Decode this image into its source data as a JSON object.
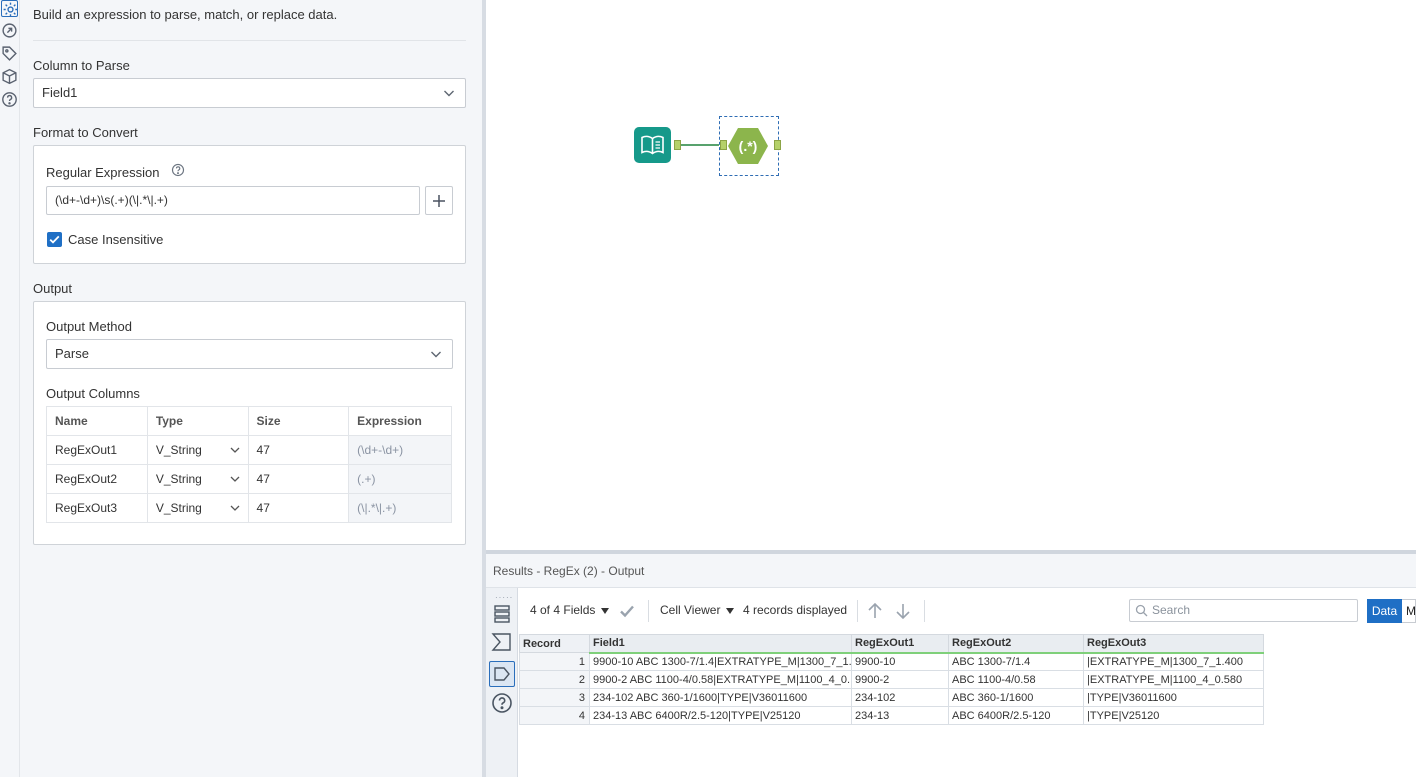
{
  "config": {
    "description": "Build an expression to parse, match, or replace data.",
    "column_to_parse_label": "Column to Parse",
    "column_to_parse_value": "Field1",
    "format_label": "Format to Convert",
    "regex_label": "Regular Expression",
    "regex_value": "(\\d+-\\d+)\\s(.+)(\\|.*\\|.+)",
    "case_insensitive_label": "Case Insensitive",
    "case_insensitive_checked": true,
    "output_label": "Output",
    "output_method_label": "Output Method",
    "output_method_value": "Parse",
    "output_columns_label": "Output Columns",
    "output_columns_headers": [
      "Name",
      "Type",
      "Size",
      "Expression"
    ],
    "output_columns": [
      {
        "name": "RegExOut1",
        "type": "V_String",
        "size": "47",
        "expression": "(\\d+-\\d+)"
      },
      {
        "name": "RegExOut2",
        "type": "V_String",
        "size": "47",
        "expression": "(.+)"
      },
      {
        "name": "RegExOut3",
        "type": "V_String",
        "size": "47",
        "expression": "(\\|.*\\|.+)"
      }
    ]
  },
  "canvas": {
    "regex_tool_glyph": "(.*)"
  },
  "results": {
    "title": "Results - RegEx (2) - Output",
    "fields_selector": "4 of 4 Fields",
    "cell_viewer": "Cell Viewer",
    "records_displayed": "4 records displayed",
    "search_placeholder": "Search",
    "data_button": "Data",
    "metadata_button": "M",
    "headers": [
      "Record",
      "Field1",
      "RegExOut1",
      "RegExOut2",
      "RegExOut3"
    ],
    "rows": [
      [
        "1",
        "9900-10  ABC  1300-7/1.4|EXTRATYPE_M|1300_7_1...",
        "9900-10",
        "ABC 1300-7/1.4",
        "|EXTRATYPE_M|1300_7_1.400"
      ],
      [
        "2",
        "9900-2  ABC  1100-4/0.58|EXTRATYPE_M|1100_4_0...",
        "9900-2",
        "ABC 1100-4/0.58",
        "|EXTRATYPE_M|1100_4_0.580"
      ],
      [
        "3",
        "234-102 ABC 360-1/1600|TYPE|V36011600",
        "234-102",
        "ABC 360-1/1600",
        "|TYPE|V36011600"
      ],
      [
        "4",
        "234-13 ABC 6400R/2.5-120|TYPE|V25120",
        "234-13",
        "ABC 6400R/2.5-120",
        "|TYPE|V25120"
      ]
    ]
  },
  "colors": {
    "accent": "#1f6fc5",
    "input_tool": "#16998a",
    "regex_tool": "#8cb54c"
  },
  "icons": {
    "rail": [
      "gear-icon",
      "connection-icon",
      "tag-icon",
      "cube-icon",
      "help-icon"
    ],
    "results_side": [
      "rows-icon",
      "sigma-icon",
      "tag-icon",
      "help-icon"
    ]
  }
}
